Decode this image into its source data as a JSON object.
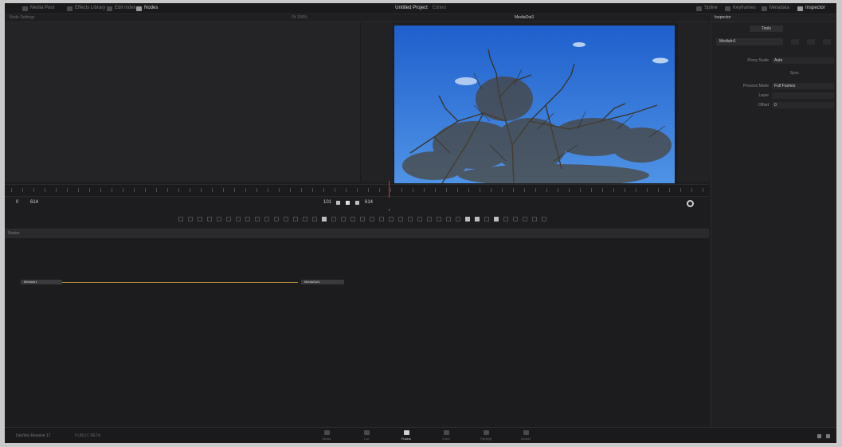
{
  "topbar": {
    "left_items": [
      "Media Pool",
      "Effects Library",
      "Edit Index",
      "Nodes"
    ],
    "project_title": "Untitled Project",
    "edited_label": "Edited",
    "right_items": [
      "Spline",
      "Keyframes",
      "Metadata",
      "Inspector"
    ]
  },
  "subbar": {
    "left_text": "Node Settings",
    "mid_text": "Fit   100%",
    "viewer_title": "MediaOut1"
  },
  "inspector": {
    "title": "Inspector",
    "tab_label": "Tools",
    "node_dropdown": "MediaIn1",
    "rows": [
      {
        "label": "Proxy Scale",
        "value": "Auto"
      },
      {
        "label": "Sync",
        "value": ""
      },
      {
        "label": "Process Mode",
        "value": "Full Frames"
      },
      {
        "label": "Layer",
        "value": ""
      },
      {
        "label": "Offset",
        "value": "0"
      }
    ]
  },
  "transport": {
    "left_a": "0",
    "left_b": "614",
    "timecode": "101",
    "end": "614"
  },
  "node_editor": {
    "title": "Nodes",
    "nodes": [
      {
        "label": "MediaIn1"
      },
      {
        "label": "MediaOut1"
      }
    ]
  },
  "bottombar": {
    "brand": "DaVinci Resolve 17",
    "brand_sub": "PUBLIC BETA",
    "pages": [
      {
        "label": "Media",
        "active": false
      },
      {
        "label": "Cut",
        "active": false
      },
      {
        "label": "Fusion",
        "active": true
      },
      {
        "label": "Color",
        "active": false
      },
      {
        "label": "Fairlight",
        "active": false
      },
      {
        "label": "Deliver",
        "active": false
      }
    ]
  },
  "colors": {
    "accent_link": "#b4893a",
    "playhead": "#c9402f",
    "sky": "#2e6fd6"
  }
}
